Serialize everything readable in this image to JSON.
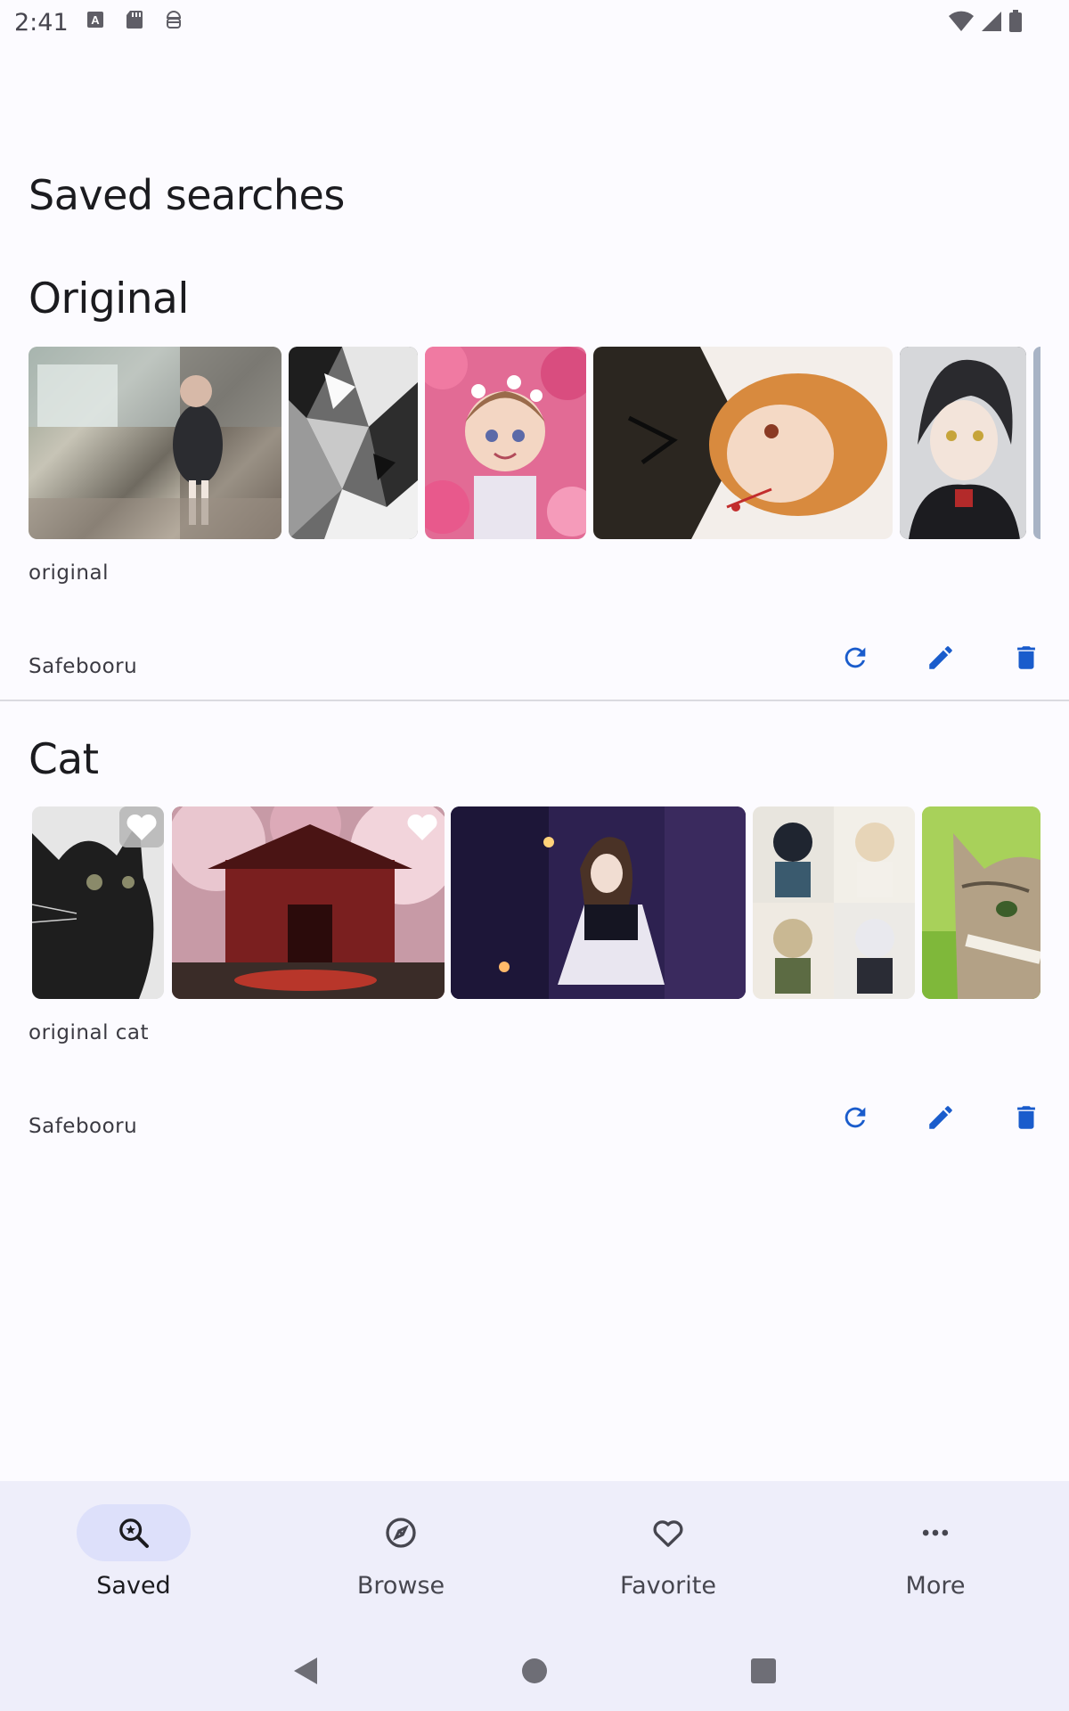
{
  "status_bar": {
    "time": "2:41",
    "left_icons": [
      "keyboard-a-icon",
      "sd-card-icon",
      "android-debug-icon"
    ],
    "right_icons": [
      "wifi-icon",
      "cell-signal-icon",
      "battery-icon"
    ]
  },
  "page_title": "Saved searches",
  "searches": [
    {
      "title": "Original",
      "query": "original",
      "source": "Safebooru",
      "thumbnails": [
        "cafe-maid-image",
        "monochrome-art-image",
        "flower-girl-image",
        "red-hair-boy-image",
        "dark-hair-boy-image",
        "partial-image"
      ]
    },
    {
      "title": "Cat",
      "query": "original cat",
      "source": "Safebooru",
      "thumbnails": [
        "black-cat-image",
        "cherry-blossom-temple-image",
        "night-maid-image",
        "chibi-grid-image",
        "tabby-cat-image"
      ]
    }
  ],
  "actions": {
    "refresh": "refresh-icon",
    "edit": "edit-pencil-icon",
    "delete": "trash-icon"
  },
  "colors": {
    "accent": "#1a5ccc",
    "nav_active_pill": "#dde0fa",
    "background": "#fcfbff",
    "nav_background": "#eeeefa"
  },
  "bottom_nav": {
    "items": [
      {
        "label": "Saved",
        "icon": "search-star-icon",
        "active": true
      },
      {
        "label": "Browse",
        "icon": "compass-icon",
        "active": false
      },
      {
        "label": "Favorite",
        "icon": "heart-icon",
        "active": false
      },
      {
        "label": "More",
        "icon": "more-dots-icon",
        "active": false
      }
    ]
  },
  "system_nav": [
    "back-icon",
    "home-icon",
    "recents-icon"
  ]
}
